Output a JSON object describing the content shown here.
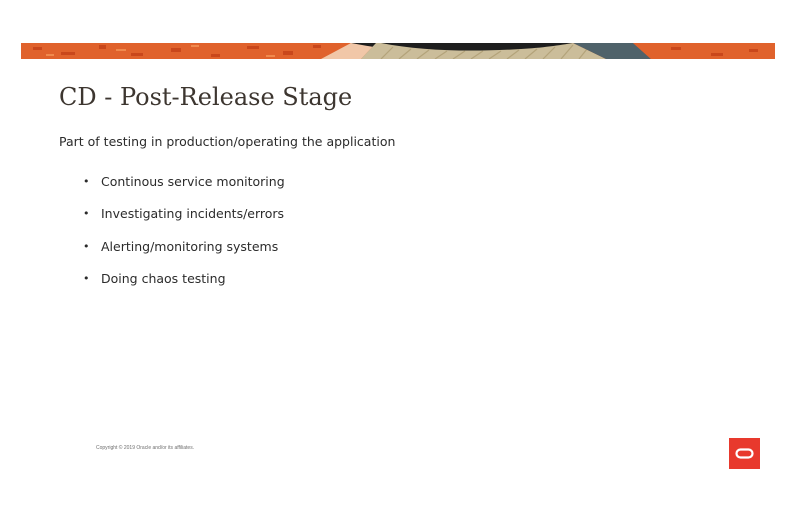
{
  "slide": {
    "title": "CD - Post-Release Stage",
    "intro": "Part of testing in production/operating the application",
    "bullets": [
      "Continous service monitoring",
      "Investigating incidents/errors",
      "Alerting/monitoring systems",
      "Doing chaos testing"
    ],
    "bullet_glyph": "•"
  },
  "footer": {
    "copyright": "Copyright © 2019 Oracle and/or its affiliates."
  },
  "colors": {
    "banner_orange": "#e0622c",
    "banner_dark": "#1e1e1e",
    "banner_sand": "#cbbd9a",
    "banner_slate": "#4f626a",
    "logo_red": "#e8392d",
    "title_text": "#3d3630"
  },
  "icons": {
    "logo": "oracle-logo-icon",
    "banner": "decorative-banner"
  }
}
